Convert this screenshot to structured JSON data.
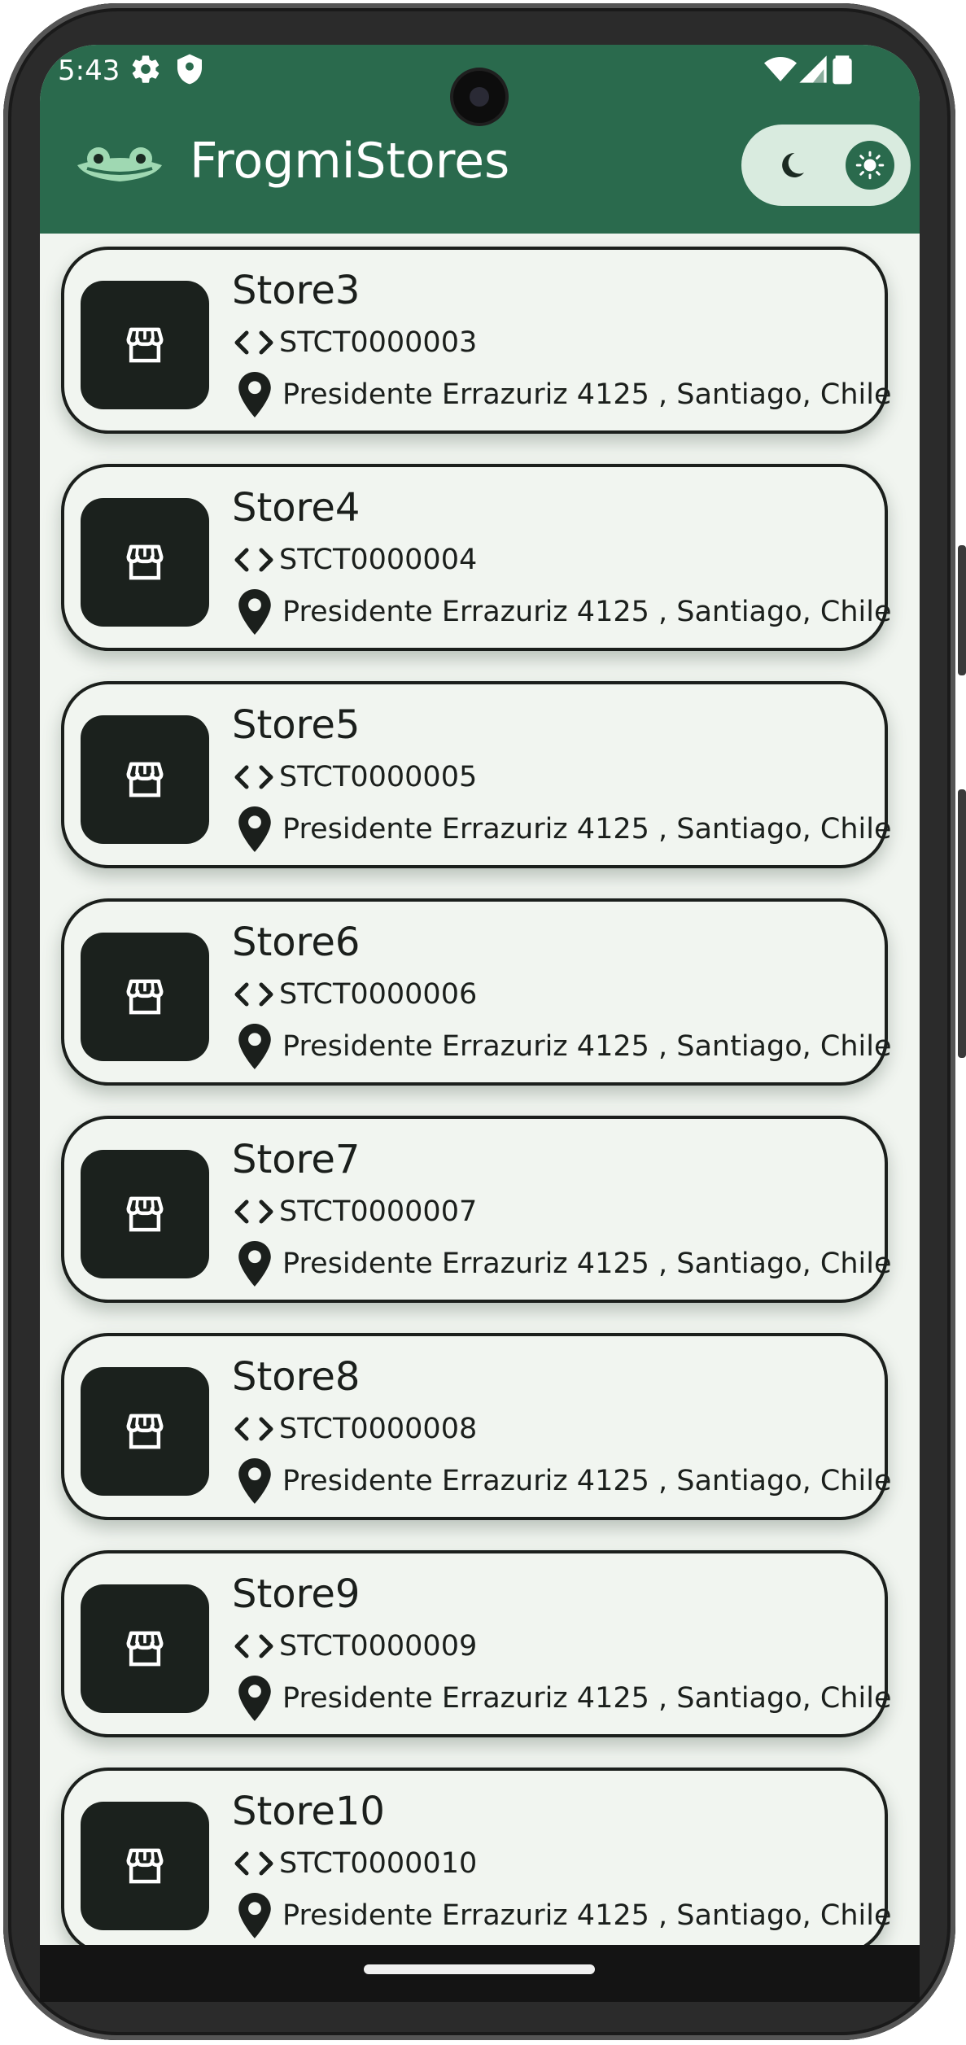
{
  "status_bar": {
    "time": "5:43",
    "icons": [
      "gear-icon",
      "shield-icon",
      "wifi-icon",
      "signal-icon",
      "battery-icon"
    ]
  },
  "app_bar": {
    "title": "FrogmiStores",
    "logo_icon": "frog-logo-icon",
    "theme_toggle": {
      "dark_icon": "moon-icon",
      "light_icon": "sun-icon",
      "selected": "light"
    }
  },
  "colors": {
    "app_bar": "#2a6a4d",
    "background": "#f1f5f0",
    "card_border": "#1b1f1c",
    "thumbnail": "#1b211d",
    "toggle_track": "#d9ebdf"
  },
  "stores": [
    {
      "name": "Store3",
      "code": "STCT0000003",
      "address": "Presidente Errazuriz 4125 , Santiago, Chile"
    },
    {
      "name": "Store4",
      "code": "STCT0000004",
      "address": "Presidente Errazuriz 4125 , Santiago, Chile"
    },
    {
      "name": "Store5",
      "code": "STCT0000005",
      "address": "Presidente Errazuriz 4125 , Santiago, Chile"
    },
    {
      "name": "Store6",
      "code": "STCT0000006",
      "address": "Presidente Errazuriz 4125 , Santiago, Chile"
    },
    {
      "name": "Store7",
      "code": "STCT0000007",
      "address": "Presidente Errazuriz 4125 , Santiago, Chile"
    },
    {
      "name": "Store8",
      "code": "STCT0000008",
      "address": "Presidente Errazuriz 4125 , Santiago, Chile"
    },
    {
      "name": "Store9",
      "code": "STCT0000009",
      "address": "Presidente Errazuriz 4125 , Santiago, Chile"
    },
    {
      "name": "Store10",
      "code": "STCT0000010",
      "address": "Presidente Errazuriz 4125 , Santiago, Chile"
    }
  ],
  "store_icons": {
    "thumbnail": "storefront-icon",
    "code": "code-brackets-icon",
    "address": "location-pin-icon"
  }
}
